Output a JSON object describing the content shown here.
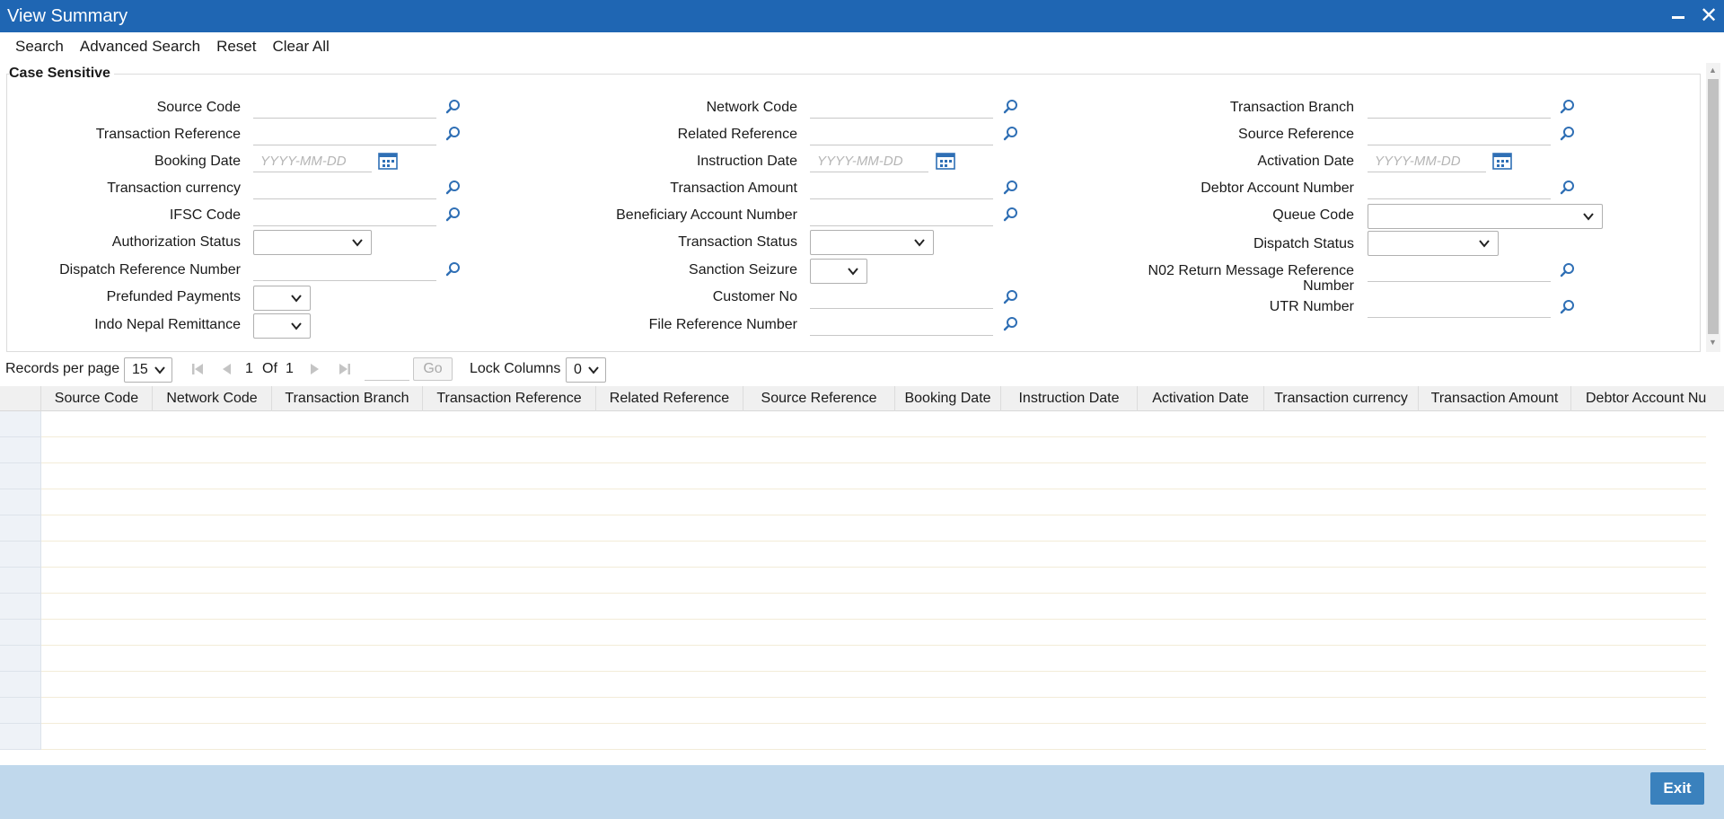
{
  "window": {
    "title": "View Summary"
  },
  "menu": [
    "Search",
    "Advanced Search",
    "Reset",
    "Clear All"
  ],
  "criteria": {
    "title": "Case Sensitive",
    "date_placeholder": "YYYY-MM-DD",
    "col1": {
      "source_code": "Source Code",
      "transaction_reference": "Transaction Reference",
      "booking_date": "Booking Date",
      "transaction_currency": "Transaction currency",
      "ifsc_code": "IFSC Code",
      "authorization_status": "Authorization Status",
      "dispatch_reference_number": "Dispatch Reference Number",
      "prefunded_payments": "Prefunded Payments",
      "indo_nepal_remittance": "Indo Nepal Remittance"
    },
    "col2": {
      "network_code": "Network Code",
      "related_reference": "Related Reference",
      "instruction_date": "Instruction Date",
      "transaction_amount": "Transaction Amount",
      "beneficiary_account_number": "Beneficiary Account Number",
      "transaction_status": "Transaction Status",
      "sanction_seizure": "Sanction Seizure",
      "customer_no": "Customer No",
      "file_reference_number": "File Reference Number"
    },
    "col3": {
      "transaction_branch": "Transaction Branch",
      "source_reference": "Source Reference",
      "activation_date": "Activation Date",
      "debtor_account_number": "Debtor Account Number",
      "queue_code": "Queue Code",
      "dispatch_status": "Dispatch Status",
      "n02_line1": "N02 Return Message Reference",
      "n02_line2": "Number",
      "utr_number": "UTR Number"
    }
  },
  "pager": {
    "records_label": "Records per page",
    "records_value": "15",
    "page": "1",
    "of_label": "Of",
    "total": "1",
    "go_label": "Go",
    "lock_label": "Lock Columns",
    "lock_value": "0"
  },
  "grid": {
    "columns": [
      "Source Code",
      "Network Code",
      "Transaction Branch",
      "Transaction Reference",
      "Related Reference",
      "Source Reference",
      "Booking Date",
      "Instruction Date",
      "Activation Date",
      "Transaction currency",
      "Transaction Amount",
      "Debtor Account Nu"
    ]
  },
  "footer": {
    "exit_label": "Exit"
  }
}
